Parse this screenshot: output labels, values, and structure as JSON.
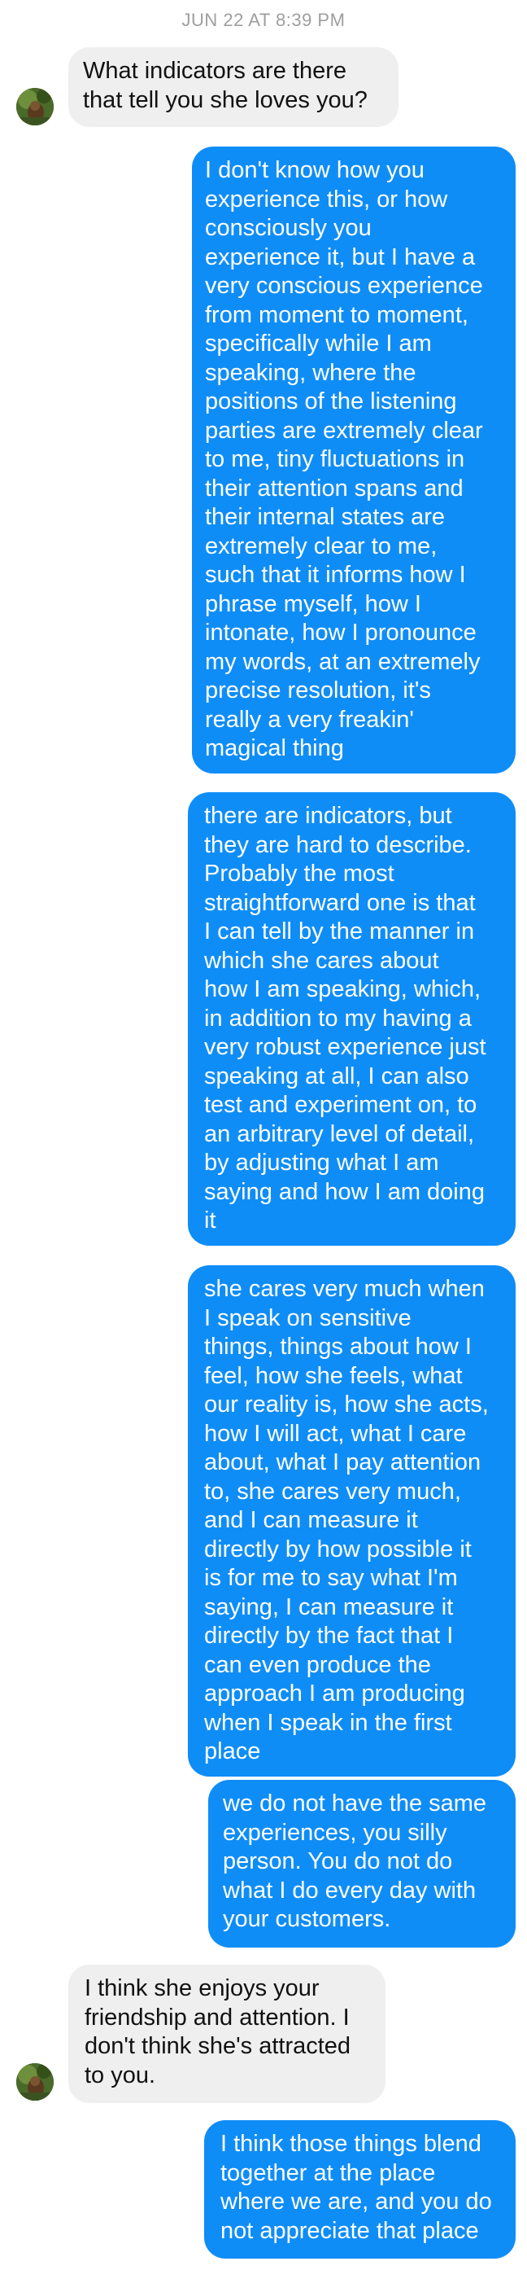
{
  "thread": {
    "timestamp": "JUN 22 AT 8:39 PM"
  },
  "messages": [
    {
      "from": "contact",
      "text": "What indicators are there\nthat tell you she loves you?"
    },
    {
      "from": "me",
      "text": "I don't know how you\nexperience this, or how\nconsciously you\nexperience it, but I have a\nvery conscious experience\nfrom moment to moment,\nspecifically while I am\nspeaking, where the\npositions of the listening\nparties are extremely clear\nto me, tiny fluctuations in\ntheir attention spans and\ntheir internal states are\nextremely clear to me,\nsuch that it informs how I\nphrase myself, how I\nintonate, how I pronounce\nmy words, at an extremely\nprecise resolution, it's\nreally a very freakin'\nmagical thing"
    },
    {
      "from": "me",
      "text": "there are indicators, but\nthey are hard to describe.\nProbably the most\nstraightforward one is that\nI can tell by the manner in\nwhich she cares about\nhow I am speaking, which,\nin addition to my having a\nvery robust experience just\nspeaking at all, I can also\ntest and experiment on, to\nan arbitrary level of detail,\nby adjusting what I am\nsaying and how I am doing\nit"
    },
    {
      "from": "me",
      "text": "she cares very much when\nI speak on sensitive\nthings, things about how I\nfeel, how she feels, what\nour reality is, how she acts,\nhow I will act, what I care\nabout, what I pay attention\nto, she cares very much,\nand I can measure it\ndirectly by how possible it\nis for me to say what I'm\nsaying, I can measure it\ndirectly by the fact that I\ncan even produce the\napproach I am producing\nwhen I speak in the first\nplace"
    },
    {
      "from": "me",
      "text": "we do not have the same\nexperiences, you silly\nperson. You do not do\nwhat I do every day with\nyour customers."
    },
    {
      "from": "contact",
      "text": "I think she enjoys your\nfriendship and attention. I\ndon't think she's attracted\nto you."
    },
    {
      "from": "me",
      "text": "I think those things blend\ntogether at the place\nwhere we are, and you do\nnot appreciate that place"
    }
  ],
  "colors": {
    "outgoing_bubble": "#0f8df7",
    "incoming_bubble": "#efefef",
    "timestamp": "#9e9e9e"
  },
  "icons": {
    "contact_avatar": "contact-avatar-photo"
  }
}
